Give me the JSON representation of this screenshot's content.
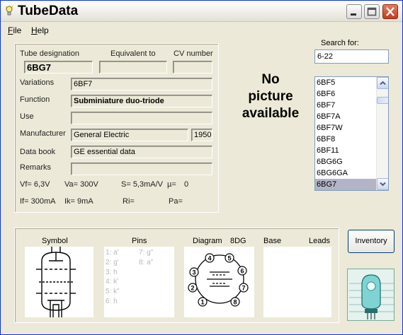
{
  "window": {
    "title": "TubeData"
  },
  "menu": {
    "file_ul": "F",
    "file_rest": "ile",
    "help_ul": "H",
    "help_rest": "elp"
  },
  "form": {
    "designation_label": "Tube designation",
    "equivalent_label": "Equivalent to",
    "cv_label": "CV number",
    "designation_value": "6BG7",
    "equivalent_value": "",
    "cv_value": "",
    "variations_label": "Variations",
    "variations_value": "6BF7",
    "function_label": "Function",
    "function_value": "Subminiature duo-triode",
    "use_label": "Use",
    "use_value": "",
    "manufacturer_label": "Manufacturer",
    "manufacturer_value": "General Electric",
    "year_value": "1950",
    "databook_label": "Data book",
    "databook_value": "GE essential data",
    "remarks_label": "Remarks",
    "remarks_value": "",
    "params_row1": {
      "vf": "Vf= 6,3V",
      "va": "Va= 300V",
      "s": "S= 5,3mA/V",
      "mu": "µ=",
      "mu_val": "0"
    },
    "params_row2": {
      "if": "If= 300mA",
      "ik": "Ik= 9mA",
      "ri": "Ri=",
      "pa": "Pa="
    }
  },
  "picture": {
    "line1": "No",
    "line2": "picture",
    "line3": "available"
  },
  "search": {
    "label": "Search for:",
    "value": "6-22"
  },
  "tube_list": {
    "items": [
      "6BF5",
      "6BF6",
      "6BF7",
      "6BF7A",
      "6BF7W",
      "6BF8",
      "6BF11",
      "6BG6G",
      "6BG6GA",
      "6BG7"
    ],
    "selected_index": 9
  },
  "bottom": {
    "symbol_label": "Symbol",
    "pins_label": "Pins",
    "diagram_label": "Diagram",
    "diagram_code": "8DG",
    "base_label": "Base",
    "leads_label": "Leads",
    "pins_col1": [
      "1: a'",
      "2: g'",
      "3: h",
      "4: k'",
      "5: k\"",
      "6: h"
    ],
    "pins_col2": [
      "7: g\"",
      "8: a\""
    ],
    "diagram_pins": [
      "1",
      "2",
      "3",
      "4",
      "5",
      "6",
      "7",
      "8"
    ]
  },
  "inventory_button": {
    "label": "Inventory"
  },
  "colors": {
    "title_bar_border": "#0831d9",
    "selection": "#b4b4c8",
    "close_button": "#c43c1e"
  }
}
